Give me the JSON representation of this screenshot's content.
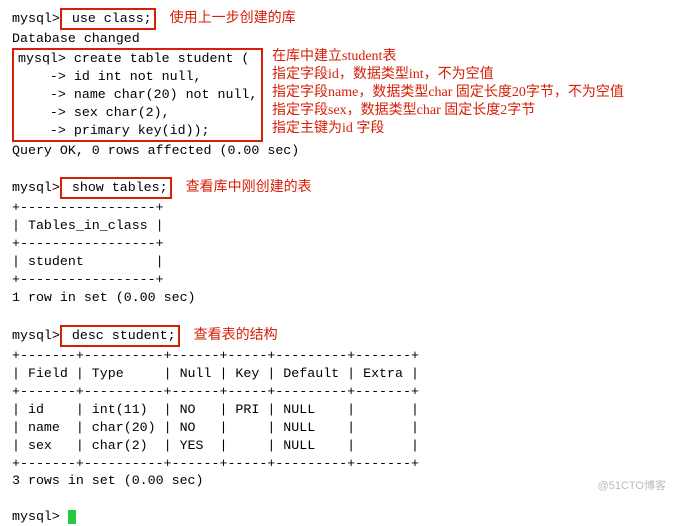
{
  "l1_prompt": "mysql>",
  "l1_cmd": " use class;",
  "l1_annot": "使用上一步创建的库",
  "l2": "Database changed",
  "create_prompt": "mysql> ",
  "create_l1": "create table student (",
  "create_l2": "    -> id int not null,",
  "create_l3": "    -> name char(20) not null,",
  "create_l4": "    -> sex char(2),",
  "create_l5": "    -> primary key(id));",
  "create_a1": "在库中建立student表",
  "create_a2": "指定字段id，数据类型int，不为空值",
  "create_a3": "指定字段name，数据类型char 固定长度20字节，不为空值",
  "create_a4": "指定字段sex，数据类型char 固定长度2字节",
  "create_a5": "指定主键为id 字段",
  "query_ok": "Query OK, 0 rows affected (0.00 sec)",
  "show_prompt": "mysql>",
  "show_cmd": " show tables;",
  "show_annot": "查看库中刚创建的表",
  "t1_border": "+-----------------+",
  "t1_header": "| Tables_in_class |",
  "t1_row": "| student         |",
  "one_row": "1 row in set (0.00 sec)",
  "desc_prompt": "mysql>",
  "desc_cmd": " desc student;",
  "desc_annot": "查看表的结构",
  "t2_border": "+-------+----------+------+-----+---------+-------+",
  "t2_header": "| Field | Type     | Null | Key | Default | Extra |",
  "t2_r1": "| id    | int(11)  | NO   | PRI | NULL    |       |",
  "t2_r2": "| name  | char(20) | NO   |     | NULL    |       |",
  "t2_r3": "| sex   | char(2)  | YES  |     | NULL    |       |",
  "three_rows": "3 rows in set (0.00 sec)",
  "final_prompt": "mysql> ",
  "watermark": "@51CTO博客",
  "chart_data": {
    "type": "table",
    "title": "desc student;",
    "columns": [
      "Field",
      "Type",
      "Null",
      "Key",
      "Default",
      "Extra"
    ],
    "rows": [
      [
        "id",
        "int(11)",
        "NO",
        "PRI",
        "NULL",
        ""
      ],
      [
        "name",
        "char(20)",
        "NO",
        "",
        "NULL",
        ""
      ],
      [
        "sex",
        "char(2)",
        "YES",
        "",
        "NULL",
        ""
      ]
    ]
  }
}
